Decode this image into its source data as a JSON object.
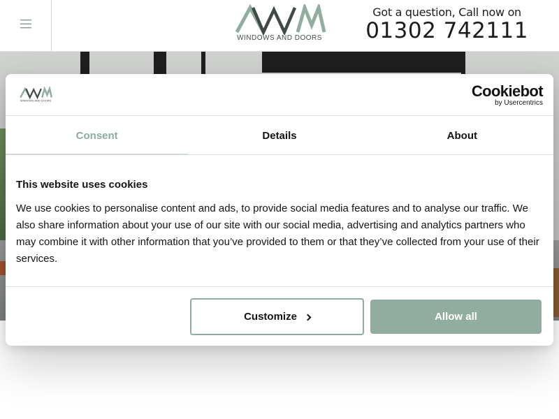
{
  "header": {
    "logo_text": "AWM",
    "logo_subtitle": "WINDOWS AND DOORS",
    "contact_question": "Got a question, Call now on",
    "contact_phone": "01302 742111"
  },
  "cookie_dialog": {
    "logo_subtitle": "WINDOWS AND DOORS",
    "brand_name": "Cookiebot",
    "brand_by": "by Usercentrics",
    "tabs": [
      {
        "label": "Consent",
        "active": true
      },
      {
        "label": "Details",
        "active": false
      },
      {
        "label": "About",
        "active": false
      }
    ],
    "title": "This website uses cookies",
    "body": "We use cookies to personalise content and ads, to provide social media features and to analyse our traffic. We also share information about your use of our site with our social media, advertising and analytics partners who may combine it with other information that you’ve provided to them or that they’ve collected from your use of their services.",
    "customize_label": "Customize",
    "allow_all_label": "Allow all"
  },
  "colors": {
    "accent": "#91ad9f",
    "logo_green": "#91ad9f",
    "logo_dark": "#3f4a45",
    "text": "#141414"
  },
  "icons": {
    "menu": "hamburger-icon",
    "customize_chevron": "chevron-right-icon"
  }
}
